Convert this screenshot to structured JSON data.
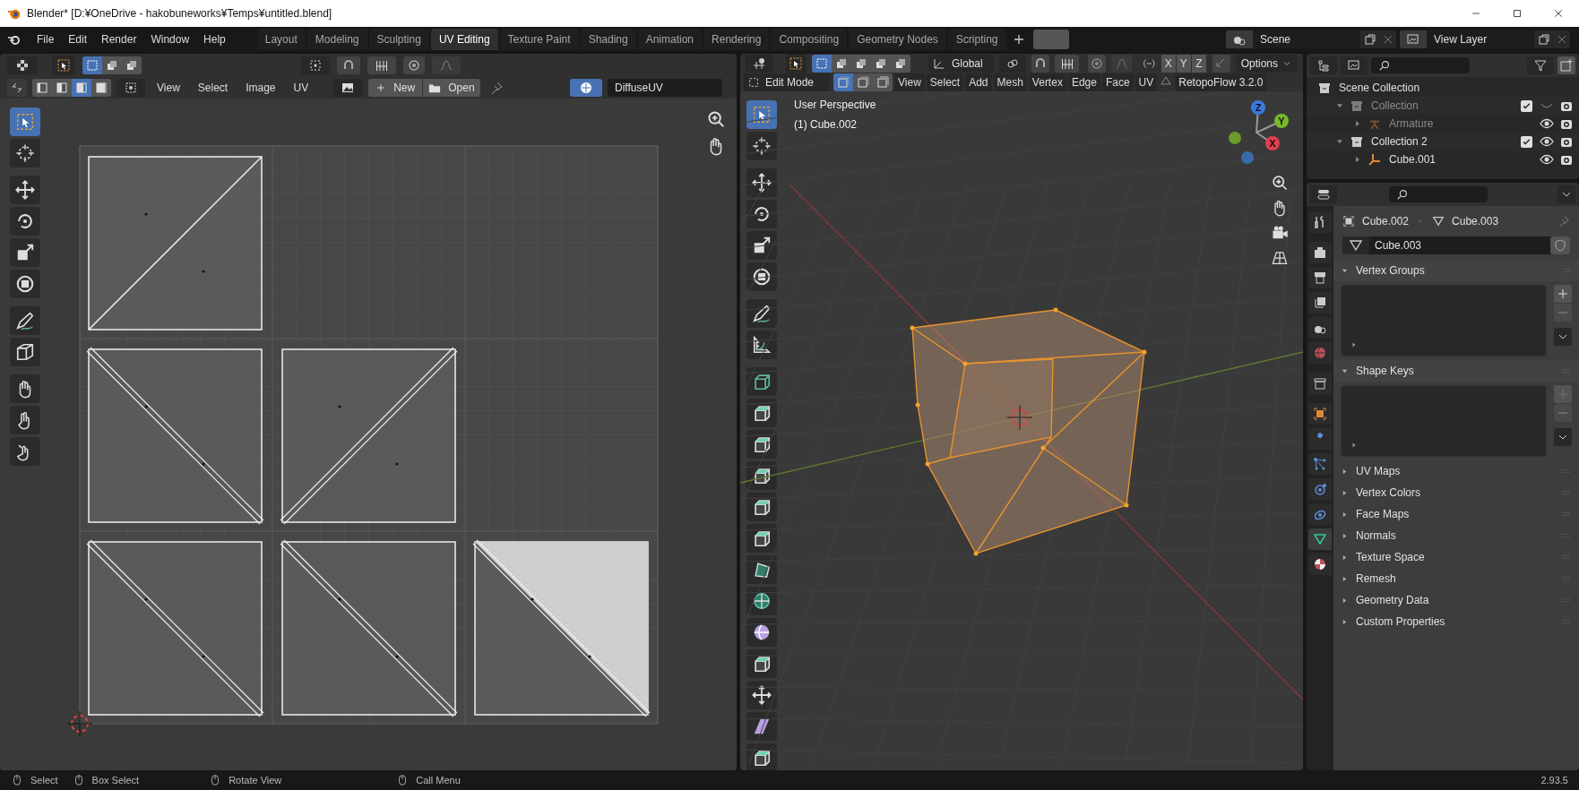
{
  "window": {
    "title": "Blender* [D:¥OneDrive - hakobuneworks¥Temps¥untitled.blend]"
  },
  "menu": [
    "File",
    "Edit",
    "Render",
    "Window",
    "Help"
  ],
  "workspaces": [
    {
      "label": "Layout",
      "selected": false
    },
    {
      "label": "Modeling",
      "selected": false
    },
    {
      "label": "Sculpting",
      "selected": false
    },
    {
      "label": "UV Editing",
      "selected": true
    },
    {
      "label": "Texture Paint",
      "selected": false
    },
    {
      "label": "Shading",
      "selected": false
    },
    {
      "label": "Animation",
      "selected": false
    },
    {
      "label": "Rendering",
      "selected": false
    },
    {
      "label": "Compositing",
      "selected": false
    },
    {
      "label": "Geometry Nodes",
      "selected": false
    },
    {
      "label": "Scripting",
      "selected": false
    }
  ],
  "scene": "Scene",
  "view_layer": "View Layer",
  "uv_editor": {
    "select_modes": [
      {
        "selected": true
      },
      {
        "selected": false
      },
      {
        "selected": false
      }
    ],
    "element_modes": [
      {
        "selected": false
      },
      {
        "selected": false
      },
      {
        "selected": true
      },
      {
        "selected": false
      }
    ],
    "menu": [
      "View",
      "Select",
      "Image",
      "UV"
    ],
    "new_button": "New",
    "open_button": "Open",
    "uv_map": "DiffuseUV",
    "tools": [
      {
        "kind": "select",
        "selected": true
      },
      {
        "kind": "cursor",
        "selected": false
      },
      {
        "kind": "move",
        "selected": false
      },
      {
        "kind": "rotate",
        "selected": false
      },
      {
        "kind": "scale",
        "selected": false
      },
      {
        "kind": "transform",
        "selected": false
      },
      {
        "kind": "annotate",
        "selected": false
      },
      {
        "kind": "rip",
        "selected": false
      },
      {
        "kind": "grab",
        "selected": false
      },
      {
        "kind": "relax",
        "selected": false
      },
      {
        "kind": "pinch",
        "selected": false
      }
    ]
  },
  "viewport": {
    "select_modes": [
      {
        "selected": true
      },
      {
        "selected": false
      },
      {
        "selected": false
      },
      {
        "selected": false
      },
      {
        "selected": false
      }
    ],
    "orientation": "Global",
    "axes": [
      "X",
      "Y",
      "Z"
    ],
    "options": "Options",
    "mode": "Edit Mode",
    "element_modes": [
      {
        "selected": true
      },
      {
        "selected": false
      },
      {
        "selected": false
      }
    ],
    "menu": [
      "View",
      "Select",
      "Add",
      "Mesh",
      "Vertex",
      "Edge",
      "Face",
      "UV"
    ],
    "addon": "RetopoFlow 3.2.0",
    "overlay": [
      "User Perspective",
      "(1) Cube.002"
    ],
    "gizmo_axes": [
      "Z",
      "Y",
      "X"
    ],
    "tools": [
      {
        "kind": "select",
        "selected": true
      },
      {
        "kind": "cursor",
        "selected": false
      },
      {
        "kind": "move",
        "selected": false
      },
      {
        "kind": "rotate",
        "selected": false
      },
      {
        "kind": "scale",
        "selected": false
      },
      {
        "kind": "transform",
        "selected": false
      },
      {
        "kind": "annotate",
        "selected": false
      },
      {
        "kind": "measure",
        "selected": false
      },
      {
        "kind": "add",
        "selected": false
      },
      {
        "kind": "cube",
        "selected": false
      },
      {
        "kind": "cube",
        "selected": false
      },
      {
        "kind": "cube",
        "selected": false
      },
      {
        "kind": "cube",
        "selected": false
      },
      {
        "kind": "cube",
        "selected": false
      },
      {
        "kind": "poly",
        "selected": false
      },
      {
        "kind": "spin",
        "selected": false
      },
      {
        "kind": "sphere",
        "selected": false
      },
      {
        "kind": "cube",
        "selected": false
      },
      {
        "kind": "move",
        "selected": false
      },
      {
        "kind": "shear",
        "selected": false
      },
      {
        "kind": "cube",
        "selected": false
      }
    ]
  },
  "outliner": {
    "items": [
      {
        "label": "Scene Collection",
        "kind": "scene",
        "children": [
          {
            "label": "Collection",
            "kind": "collection",
            "expanded": true,
            "checked": true,
            "visible": false,
            "children": [
              {
                "label": "Armature",
                "kind": "armature",
                "expanded": false,
                "visible": true
              }
            ]
          },
          {
            "label": "Collection 2",
            "kind": "collection",
            "expanded": true,
            "checked": true,
            "visible": true,
            "children": [
              {
                "label": "Cube.001",
                "kind": "object",
                "expanded": false,
                "visible": true
              }
            ]
          }
        ]
      }
    ]
  },
  "properties": {
    "tabs": [
      {
        "kind": "tool",
        "selected": false
      },
      {
        "kind": "render",
        "selected": false
      },
      {
        "kind": "output",
        "selected": false
      },
      {
        "kind": "view_layer",
        "selected": false
      },
      {
        "kind": "scene",
        "selected": false
      },
      {
        "kind": "world",
        "selected": false
      },
      {
        "kind": "collection",
        "selected": false
      },
      {
        "kind": "object",
        "selected": false
      },
      {
        "kind": "modifier",
        "selected": false
      },
      {
        "kind": "particles",
        "selected": false
      },
      {
        "kind": "physics",
        "selected": false
      },
      {
        "kind": "constraint",
        "selected": false
      },
      {
        "kind": "data",
        "selected": true
      },
      {
        "kind": "material",
        "selected": false
      }
    ],
    "breadcrumb": [
      "Cube.002",
      "Cube.003"
    ],
    "data_name": "Cube.003",
    "panels": [
      {
        "title": "Vertex Groups",
        "expanded": true
      },
      {
        "title": "Shape Keys",
        "expanded": true
      },
      {
        "title": "UV Maps",
        "expanded": false
      },
      {
        "title": "Vertex Colors",
        "expanded": false
      },
      {
        "title": "Face Maps",
        "expanded": false
      },
      {
        "title": "Normals",
        "expanded": false
      },
      {
        "title": "Texture Space",
        "expanded": false
      },
      {
        "title": "Remesh",
        "expanded": false
      },
      {
        "title": "Geometry Data",
        "expanded": false
      },
      {
        "title": "Custom Properties",
        "expanded": false
      }
    ]
  },
  "status_bar": {
    "hints": [
      "Select",
      "Box Select",
      "Rotate View",
      "Call Menu"
    ],
    "version": "2.93.5"
  }
}
